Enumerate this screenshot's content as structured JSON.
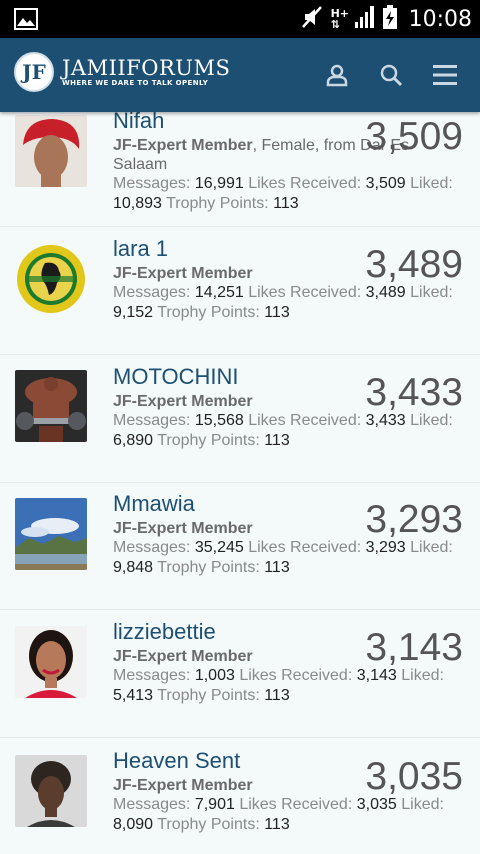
{
  "status_bar": {
    "time": "10:08",
    "network": "H+",
    "icons": [
      "image-icon",
      "mute-icon",
      "network-icon",
      "signal-icon",
      "battery-charging-icon"
    ]
  },
  "header": {
    "logo_letter": "JF",
    "logo_title": "JAMIIFORUMS",
    "logo_tagline": "WHERE WE DARE TO TALK OPENLY",
    "icons": [
      "user-icon",
      "search-icon",
      "menu-icon"
    ]
  },
  "labels": {
    "messages": "Messages:",
    "likes_received": "Likes Received:",
    "liked": "Liked:",
    "trophy_points": "Trophy Points:"
  },
  "members": [
    {
      "name": "Nifah",
      "title": "JF-Expert Member",
      "extra": ", Female, from Dar Es Salaam",
      "messages": "16,991",
      "likes_received": "3,509",
      "liked": "10,893",
      "trophy_points": "113",
      "score": "3,509"
    },
    {
      "name": "lara 1",
      "title": "JF-Expert Member",
      "extra": "",
      "messages": "14,251",
      "likes_received": "3,489",
      "liked": "9,152",
      "trophy_points": "113",
      "score": "3,489"
    },
    {
      "name": "MOTOCHINI",
      "title": "JF-Expert Member",
      "extra": "",
      "messages": "15,568",
      "likes_received": "3,433",
      "liked": "6,890",
      "trophy_points": "113",
      "score": "3,433"
    },
    {
      "name": "Mmawia",
      "title": "JF-Expert Member",
      "extra": "",
      "messages": "35,245",
      "likes_received": "3,293",
      "liked": "9,848",
      "trophy_points": "113",
      "score": "3,293"
    },
    {
      "name": "lizziebettie",
      "title": "JF-Expert Member",
      "extra": "",
      "messages": "1,003",
      "likes_received": "3,143",
      "liked": "5,413",
      "trophy_points": "113",
      "score": "3,143"
    },
    {
      "name": "Heaven Sent",
      "title": "JF-Expert Member",
      "extra": "",
      "messages": "7,901",
      "likes_received": "3,035",
      "liked": "8,090",
      "trophy_points": "113",
      "score": "3,035"
    }
  ]
}
